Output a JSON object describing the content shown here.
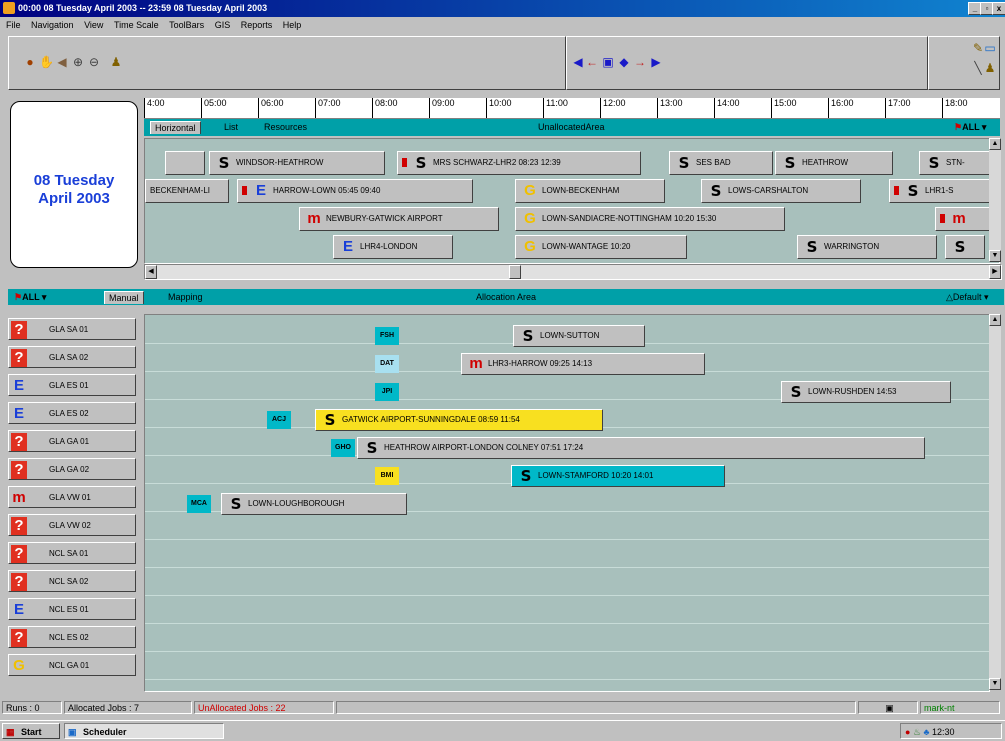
{
  "window": {
    "title": "00:00 08 Tuesday April 2003 -- 23:59 08 Tuesday April 2003"
  },
  "window_buttons": [
    "_",
    "▫",
    "x"
  ],
  "menu": [
    "File",
    "Navigation",
    "View",
    "Time Scale",
    "ToolBars",
    "GIS",
    "Reports",
    "Help"
  ],
  "date_panel": {
    "line1": "08 Tuesday",
    "line2": "April 2003"
  },
  "timescale": [
    "4:00",
    "05:00",
    "06:00",
    "07:00",
    "08:00",
    "09:00",
    "10:00",
    "11:00",
    "12:00",
    "13:00",
    "14:00",
    "15:00",
    "16:00",
    "17:00",
    "18:00"
  ],
  "unalloc_bar": {
    "tabs": [
      "Horizontal",
      "List",
      "Resources"
    ],
    "title": "UnallocatedArea",
    "filter": "ALL"
  },
  "unalloc_rows": [
    [
      {
        "icon": "s-icon",
        "glyph": "S",
        "text": "WINDSOR-HEATHROW"
      },
      {
        "icon": "s-icon",
        "glyph": "S",
        "text": "MRS SCHWARZ-LHR2 08:23 12:39",
        "flag": true
      },
      {
        "icon": "s-icon",
        "glyph": "S",
        "text": "SES BAD"
      },
      {
        "icon": "s-icon",
        "glyph": "S",
        "text": "HEATHROW"
      },
      {
        "icon": "s-icon",
        "glyph": "S",
        "text": "STN-"
      }
    ],
    [
      {
        "icon": "",
        "glyph": "",
        "text": "BECKENHAM-LI"
      },
      {
        "icon": "e-icon",
        "glyph": "E",
        "text": "HARROW-LOWN 05:45 09:40",
        "flag": true
      },
      {
        "icon": "g-icon",
        "glyph": "G",
        "text": "LOWN-BECKENHAM"
      },
      {
        "icon": "s-icon",
        "glyph": "S",
        "text": "LOWS-CARSHALTON"
      },
      {
        "icon": "s-icon",
        "glyph": "S",
        "text": "LHR1-S",
        "flag": true
      }
    ],
    [
      {
        "icon": "m-icon",
        "glyph": "m",
        "text": "NEWBURY-GATWICK AIRPORT"
      },
      {
        "icon": "g-icon",
        "glyph": "G",
        "text": "LOWN-SANDIACRE-NOTTINGHAM 10:20 15:30"
      },
      {
        "icon": "m-icon",
        "glyph": "m",
        "text": "",
        "flag": true
      }
    ],
    [
      {
        "icon": "e-icon",
        "glyph": "E",
        "text": "LHR4-LONDON"
      },
      {
        "icon": "g-icon",
        "glyph": "G",
        "text": "LOWN-WANTAGE 10:20"
      },
      {
        "icon": "s-icon",
        "glyph": "S",
        "text": "WARRINGTON"
      },
      {
        "icon": "s-icon",
        "glyph": "S",
        "text": ""
      }
    ]
  ],
  "alloc_bar": {
    "filter": "ALL",
    "tabs": [
      "Manual",
      "Mapping"
    ],
    "title": "Allocation Area",
    "default": "Default"
  },
  "resources": [
    {
      "icon": "q-icon",
      "glyph": "?",
      "label": "GLA SA 01"
    },
    {
      "icon": "q-icon",
      "glyph": "?",
      "label": "GLA SA 02"
    },
    {
      "icon": "e-icon",
      "glyph": "E",
      "label": "GLA ES 01"
    },
    {
      "icon": "e-icon",
      "glyph": "E",
      "label": "GLA ES 02"
    },
    {
      "icon": "q-icon",
      "glyph": "?",
      "label": "GLA GA 01"
    },
    {
      "icon": "q-icon",
      "glyph": "?",
      "label": "GLA GA 02"
    },
    {
      "icon": "m-icon",
      "glyph": "m",
      "label": "GLA VW 01"
    },
    {
      "icon": "q-icon",
      "glyph": "?",
      "label": "GLA VW 02"
    },
    {
      "icon": "q-icon",
      "glyph": "?",
      "label": "NCL SA 01"
    },
    {
      "icon": "q-icon",
      "glyph": "?",
      "label": "NCL SA 02"
    },
    {
      "icon": "e-icon",
      "glyph": "E",
      "label": "NCL ES 01"
    },
    {
      "icon": "q-icon",
      "glyph": "?",
      "label": "NCL ES 02"
    },
    {
      "icon": "g-icon",
      "glyph": "G",
      "label": "NCL GA 01"
    }
  ],
  "alloc_rows": [
    {
      "code": "FSH",
      "code_color": "#00b8c8",
      "job_glyph": "S",
      "job_icon": "s-icon",
      "job": "LOWN-SUTTON",
      "highlight": ""
    },
    {
      "code": "DAT",
      "code_color": "#a8e0f0",
      "job_glyph": "m",
      "job_icon": "m-icon",
      "job": "LHR3-HARROW 09:25 14:13",
      "highlight": ""
    },
    {
      "code": "JPI",
      "code_color": "#00b8c8",
      "job_glyph": "S",
      "job_icon": "s-icon",
      "job": "LOWN-RUSHDEN 14:53",
      "highlight": ""
    },
    {
      "code": "ACJ",
      "code_color": "#00b8c8",
      "job_glyph": "S",
      "job_icon": "s-icon",
      "job": "GATWICK AIRPORT-SUNNINGDALE 08:59 11:54",
      "highlight": "#f8e020"
    },
    {
      "code": "GHO",
      "code_color": "#00b8c8",
      "job_glyph": "S",
      "job_icon": "s-icon",
      "job": "HEATHROW AIRPORT-LONDON COLNEY 07:51 17:24",
      "highlight": ""
    },
    {
      "code": "BMI",
      "code_color": "#f8e020",
      "job_glyph": "S",
      "job_icon": "s-icon",
      "job": "LOWN-STAMFORD 10:20 14:01",
      "highlight": "#00b8c8"
    },
    {
      "code": "MCA",
      "code_color": "#00b8c8",
      "job_glyph": "S",
      "job_icon": "s-icon",
      "job": "LOWN-LOUGHBOROUGH",
      "highlight": ""
    }
  ],
  "status": {
    "runs": "Runs : 0",
    "allocated": "Allocated Jobs : 7",
    "unallocated": "UnAllocated Jobs : 22",
    "user": "mark-nt"
  },
  "taskbar": {
    "start": "Start",
    "app": "Scheduler",
    "clock": "12:30"
  },
  "colors": {
    "teal": "#00a0a8",
    "gantt_bg": "#a8c0bc",
    "title_start": "#000080",
    "title_end": "#1084d0",
    "unallocated_text": "#d00000",
    "user_text": "#008000"
  }
}
